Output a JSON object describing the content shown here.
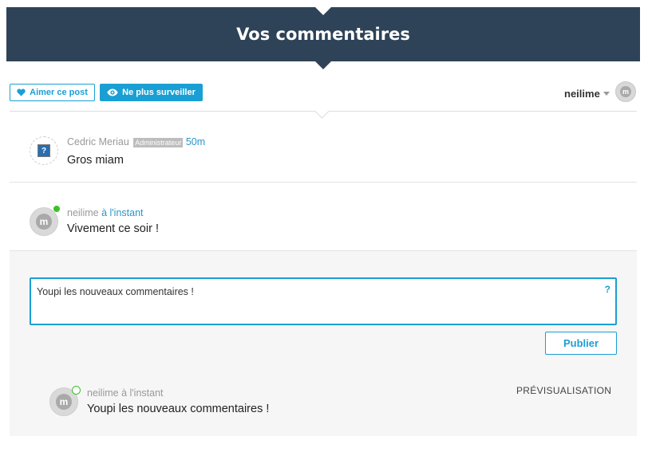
{
  "header": {
    "title": "Vos commentaires"
  },
  "toolbar": {
    "like_label": "Aimer ce post",
    "watch_label": "Ne plus surveiller",
    "username": "neilime"
  },
  "comments": [
    {
      "author": "Cedric Meriau",
      "badge": "Administrateur",
      "time": "50m",
      "text": "Gros miam"
    },
    {
      "author": "neilime",
      "time": "à l'instant",
      "text": "Vivement ce soir !",
      "online": true
    }
  ],
  "editor": {
    "value": "Youpi les nouveaux commentaires !",
    "help": "?",
    "publish_label": "Publier"
  },
  "preview": {
    "label": "PRÉVISUALISATION",
    "author": "neilime",
    "time": "à l'instant",
    "text": "Youpi les nouveaux commentaires !"
  },
  "colors": {
    "header_bg": "#2e4357",
    "accent": "#1a9fd4",
    "online": "#3cc12a"
  },
  "icons": [
    "heart-icon",
    "eye-icon",
    "caret-down-icon",
    "avatar-logo-icon",
    "unknown-avatar-icon",
    "help-icon"
  ]
}
